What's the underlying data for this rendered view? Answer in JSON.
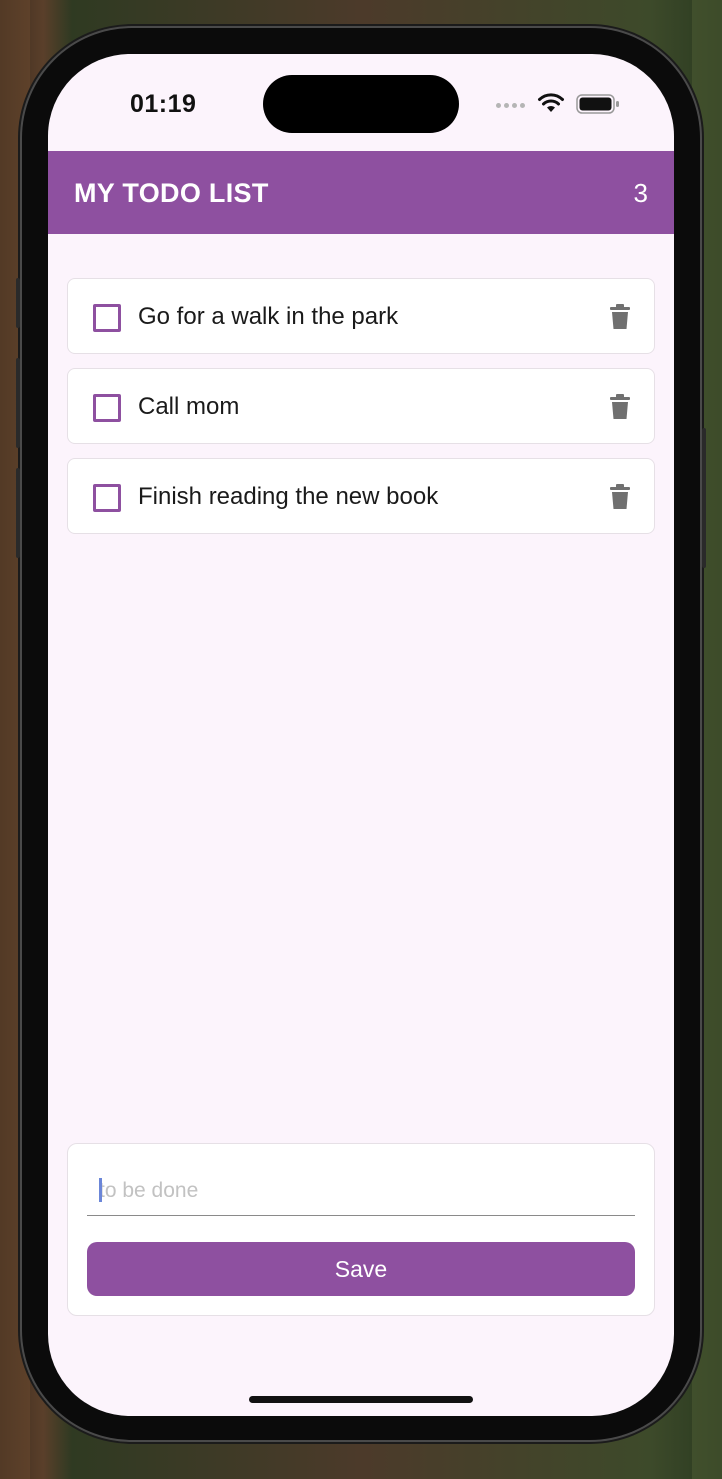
{
  "status_bar": {
    "time": "01:19"
  },
  "app_bar": {
    "title": "MY TODO LIST",
    "count": "3"
  },
  "todos": [
    {
      "text": "Go for a walk in the park",
      "done": false
    },
    {
      "text": "Call mom",
      "done": false
    },
    {
      "text": "Finish reading the new book",
      "done": false
    }
  ],
  "form": {
    "input_value": "",
    "placeholder": "to be done",
    "save_label": "Save"
  },
  "colors": {
    "accent": "#8e50a0",
    "background": "#fcf4fc",
    "icon_gray": "#707070"
  },
  "icons": {
    "trash": "trash-icon",
    "wifi": "wifi-icon",
    "battery": "battery-icon"
  }
}
